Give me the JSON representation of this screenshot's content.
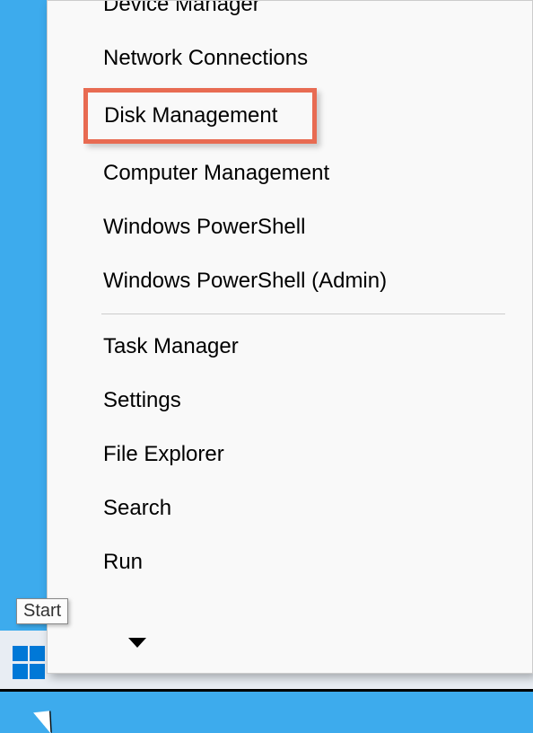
{
  "tooltip": "Start",
  "menu": {
    "items": [
      {
        "label": "Device Manager"
      },
      {
        "label": "Network Connections"
      },
      {
        "label": "Disk Management",
        "highlighted": true
      },
      {
        "label": "Computer Management"
      },
      {
        "label": "Windows PowerShell"
      },
      {
        "label": "Windows PowerShell (Admin)"
      },
      {
        "separator": true
      },
      {
        "label": "Task Manager"
      },
      {
        "label": "Settings"
      },
      {
        "label": "File Explorer"
      },
      {
        "label": "Search"
      },
      {
        "label": "Run"
      }
    ]
  },
  "icons": {
    "start": "windows-logo",
    "submenu": "chevron-down"
  }
}
